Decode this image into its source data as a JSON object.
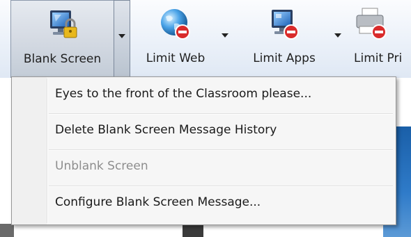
{
  "toolbar": {
    "buttons": [
      {
        "label": "Blank Screen",
        "icon": "monitor-lock-icon",
        "pressed": true
      },
      {
        "label": "Limit Web",
        "icon": "globe-blocked-icon",
        "pressed": false
      },
      {
        "label": "Limit Apps",
        "icon": "apps-blocked-icon",
        "pressed": false
      },
      {
        "label": "Limit Pri",
        "icon": "printer-blocked-icon",
        "pressed": false
      }
    ]
  },
  "menu": {
    "items": [
      {
        "label": "Eyes to the front of the Classroom please...",
        "enabled": true
      },
      {
        "label": "Delete Blank Screen Message History",
        "enabled": true
      },
      {
        "label": "Unblank Screen",
        "enabled": false
      },
      {
        "label": "Configure Blank Screen Message...",
        "enabled": true
      }
    ]
  },
  "colors": {
    "toolbar_top": "#fbfcfe",
    "toolbar_bottom": "#dfe8f4",
    "menu_bg": "#f6f6f6",
    "disabled_text": "#8d8d8d",
    "block_red": "#d92b2b"
  }
}
